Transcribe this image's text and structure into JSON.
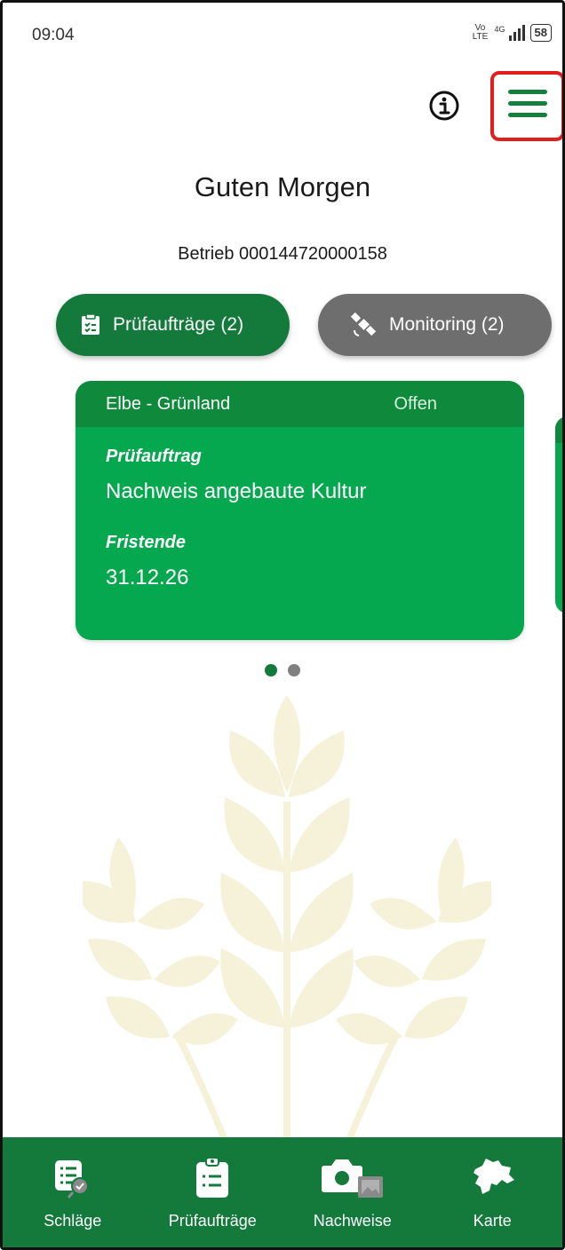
{
  "status_bar": {
    "time": "09:04",
    "volte": "Vo LTE",
    "network": "4G",
    "battery": "58"
  },
  "header": {
    "info_icon": "info-icon",
    "menu_icon": "hamburger-menu-icon",
    "greeting": "Guten Morgen",
    "betrieb": "Betrieb 000144720000158"
  },
  "chips": {
    "pruefauftraege_label": "Prüfaufträge (2)",
    "monitoring_label": "Monitoring (2)"
  },
  "card": {
    "field": "Elbe - Grünland",
    "status": "Offen",
    "label_auftrag": "Prüfauftrag",
    "auftrag": "Nachweis angebaute Kultur",
    "label_frist": "Fristende",
    "frist": "31.12.26"
  },
  "pager": {
    "count": 2,
    "active": 0
  },
  "bottom_nav": {
    "schlaege": "Schläge",
    "pruefauftraege": "Prüfaufträge",
    "nachweise": "Nachweise",
    "karte": "Karte"
  },
  "colors": {
    "primary": "#137a3c",
    "card": "#05a84f",
    "card_header": "#0f8a3d",
    "chip_inactive": "#6e6e6e",
    "highlight": "#e01e1e",
    "wheat": "#f5f1d8"
  }
}
